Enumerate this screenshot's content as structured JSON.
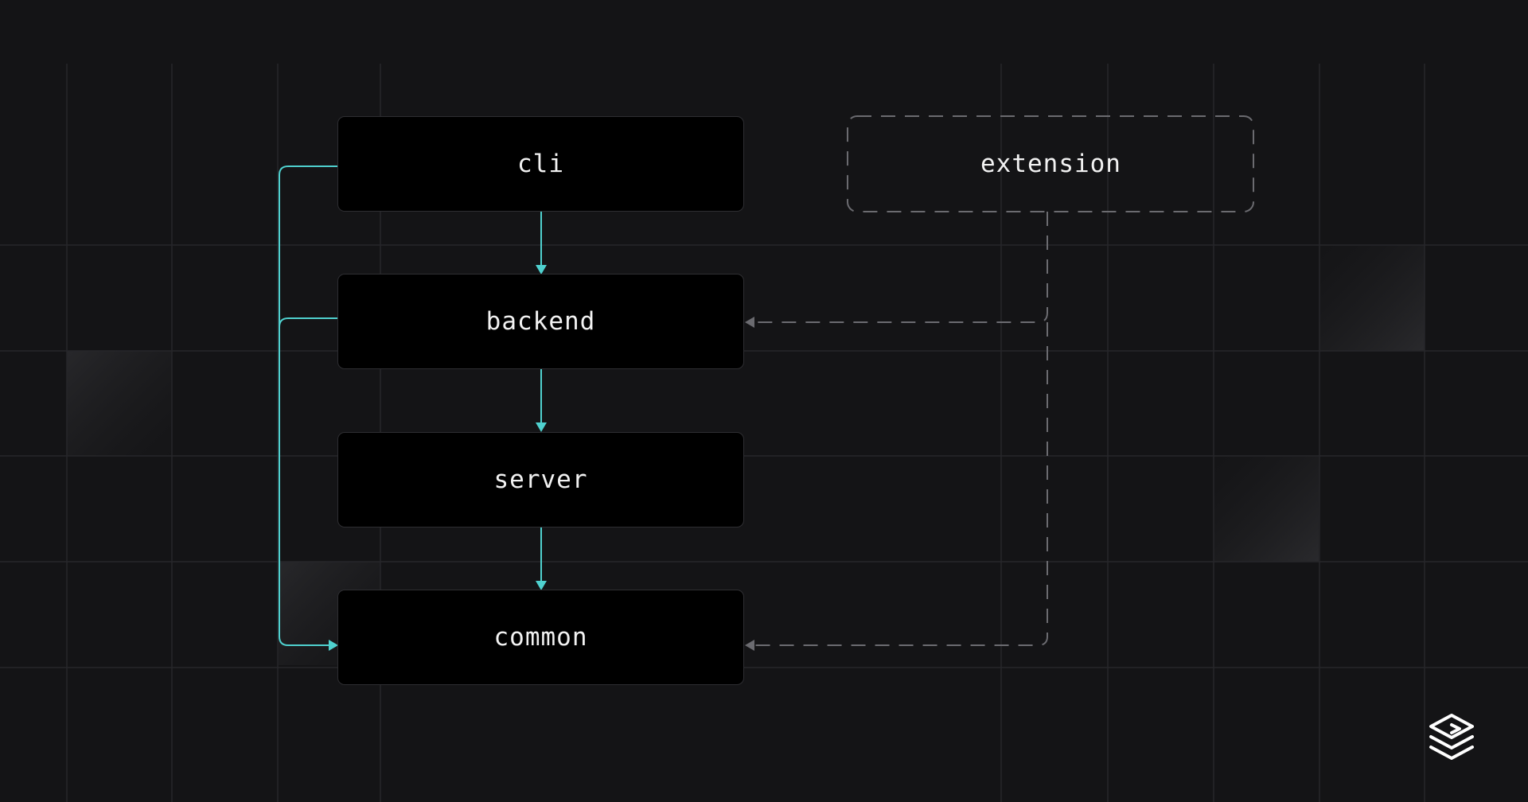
{
  "diagram": {
    "nodes": [
      {
        "id": "cli",
        "label": "cli",
        "style": "solid"
      },
      {
        "id": "backend",
        "label": "backend",
        "style": "solid"
      },
      {
        "id": "server",
        "label": "server",
        "style": "solid"
      },
      {
        "id": "common",
        "label": "common",
        "style": "solid"
      },
      {
        "id": "extension",
        "label": "extension",
        "style": "dashed"
      }
    ],
    "edges": [
      {
        "from": "cli",
        "to": "backend",
        "style": "solid"
      },
      {
        "from": "backend",
        "to": "server",
        "style": "solid"
      },
      {
        "from": "server",
        "to": "common",
        "style": "solid"
      },
      {
        "from": "cli",
        "to": "common",
        "style": "solid"
      },
      {
        "from": "backend",
        "to": "common",
        "style": "solid"
      },
      {
        "from": "extension",
        "to": "backend",
        "style": "dashed"
      },
      {
        "from": "extension",
        "to": "common",
        "style": "dashed"
      }
    ]
  },
  "colors": {
    "background": "#141416",
    "node_fill": "#000000",
    "node_border": "#2e2e32",
    "accent": "#4fd1cf",
    "dashed": "#6b6b70",
    "text": "#f2f2f2"
  },
  "logo": {
    "icon": "stacked-layers-logo"
  }
}
